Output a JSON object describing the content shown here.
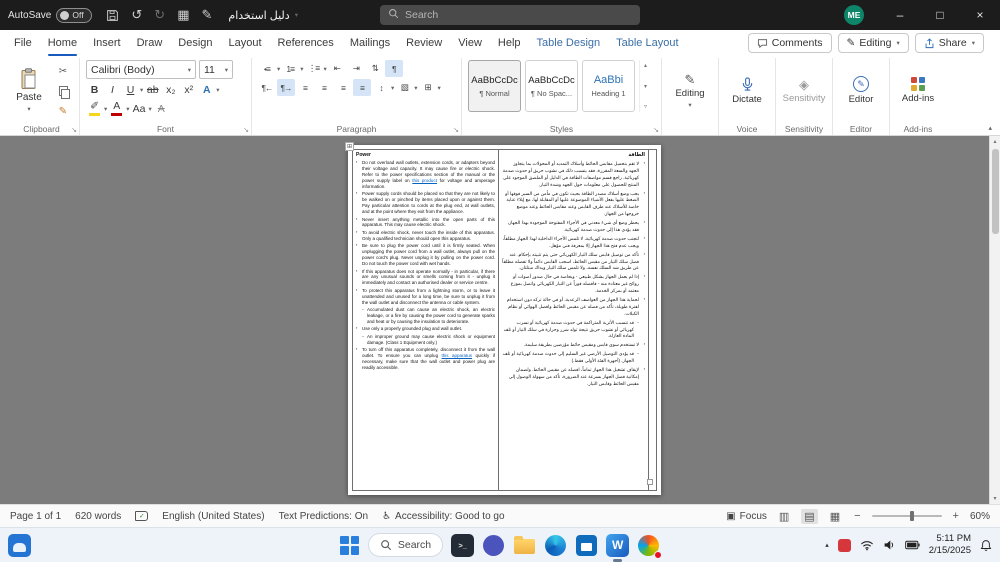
{
  "colors": {
    "accent_blue": "#185abd",
    "titlebar_bg": "#1c1c1c",
    "contextual_tab_blue": "#3a6ea5",
    "link_blue": "#0563c1",
    "heading_style_blue": "#2e74b5",
    "taskbar_bg": "#eef3f9",
    "notification_red": "#e81123"
  },
  "icons": {
    "undo": "↺",
    "redo": "↻",
    "table": "▦",
    "pen": "✎",
    "chevron_down": "▾",
    "minimize": "–",
    "maximize": "□",
    "close": "×",
    "cut": "✂",
    "format_painter": "✎",
    "launcher": "↘",
    "collapse": "▴",
    "bullets": "•≡",
    "numbering": "1≡",
    "multilevel": "⋮≡",
    "outdent": "⇤",
    "indent": "⇥",
    "sort": "⇅",
    "pilcrow": "¶",
    "rtl": "¶←",
    "ltr": "¶→",
    "align": "≡",
    "line_spacing": "↕",
    "shading": "▧",
    "borders": "⊞",
    "styles_up": "▴",
    "styles_down": "▾",
    "styles_more": "▿",
    "editing_pencil": "✎",
    "sensitivity": "◈",
    "editor_pencil": "✎",
    "highlight_pen": "✐",
    "focus": "▣",
    "view_read": "▥",
    "view_print": "▤",
    "view_web": "▦",
    "zoom_out": "−",
    "zoom_in": "+",
    "spell_check": "✓",
    "accessibility": "♿",
    "scroll_up": "▴",
    "scroll_down": "▾",
    "table_handle": "⊞",
    "tray_chevron": "▴",
    "terminal": ">_"
  },
  "titlebar": {
    "autosave_label": "AutoSave",
    "autosave_state": "Off",
    "doc_title": "دليل استخدام",
    "search_placeholder": "Search",
    "avatar": "ME"
  },
  "menubar": {
    "tabs": [
      "File",
      "Home",
      "Insert",
      "Draw",
      "Design",
      "Layout",
      "References",
      "Mailings",
      "Review",
      "View",
      "Help",
      "Table Design",
      "Table Layout"
    ],
    "active_tab": "Home",
    "comments": "Comments",
    "editing": "Editing",
    "share": "Share"
  },
  "ribbon": {
    "clipboard": {
      "paste": "Paste",
      "label": "Clipboard"
    },
    "font": {
      "name": "Calibri (Body)",
      "size": "11",
      "label": "Font",
      "bold": "B",
      "italic": "I",
      "underline": "U",
      "strike": "ab",
      "subscript": "x₂",
      "superscript": "x²",
      "effects": "A",
      "color": "A",
      "change_case": "Aa",
      "clear": "A"
    },
    "paragraph": {
      "label": "Paragraph"
    },
    "styles": {
      "label": "Styles",
      "items": [
        {
          "preview": "AaBbCcDc",
          "name": "¶ Normal"
        },
        {
          "preview": "AaBbCcDc",
          "name": "¶ No Spac..."
        },
        {
          "preview": "AaBbi",
          "name": "Heading 1"
        }
      ]
    },
    "editing": {
      "button": "Editing"
    },
    "voice": {
      "button": "Dictate",
      "label": "Voice"
    },
    "sensitivity": {
      "button": "Sensitivity",
      "label": "Sensitivity"
    },
    "editor": {
      "button": "Editor",
      "label": "Editor"
    },
    "addins": {
      "button": "Add-ins",
      "label": "Add-ins"
    }
  },
  "document": {
    "heading_en": "Power",
    "heading_ar": "الطاقة",
    "english": [
      {
        "t1": "Do not overload wall outlets, extension cords, or adapters beyond their voltage and capacity. It may cause fire or electric shock. Refer to the power specifications section of the manual or the power supply label on ",
        "link": "this product",
        "t2": " for voltage and amperage information."
      },
      "Power supply cords should be placed so that they are not likely to be walked on or pinched by items placed upon or against them. Pay particular attention to cords at the plug end, at wall outlets, and at the point where they exit from the appliance.",
      "Never insert anything metallic into the open parts of this apparatus. This may cause electric shock.",
      "To avoid electric shock, never touch the inside of this apparatus. Only a qualified technician should open this apparatus.",
      "Be sure to plug the power cord until it is firmly seated. When unplugging the power cord from a wall outlet, always pull on the power cord's plug. Never unplug it by pulling on the power cord. Do not touch the power cord with wet hands.",
      "If this apparatus does not operate normally - in particular, if there are any unusual sounds or smells coming from it - unplug it immediately and contact an authorised dealer or service centre.",
      "To protect this apparatus from a lightning storm, or to leave it unattended and unused for a long time, be sure to unplug it from the wall outlet and disconnect the antenna or cable system.",
      "Accumulated dust can cause an electric shock, an electric leakage, or a fire by causing the power cord to generate sparks and heat or by causing the insulation to deteriorate.",
      "Use only a properly grounded plug and wall outlet.",
      "An improper ground may cause electric shock or equipment damage. (Class 1 Equipment only.)",
      {
        "t1": "To turn off this apparatus completely, disconnect it from the wall outlet. To ensure you can unplug ",
        "link": "this apparatus",
        "t2": " quickly if necessary, make sure that the wall outlet and power plug are readily accessible."
      }
    ],
    "arabic": [
      "لا تقم بتحميل مقابس الحائط وأسلاك التمديد أو المحولات بما يتجاوز الجهد والسعة المقررة، فقد يتسبب ذلك في نشوب حريق أو حدوث صدمة كهربائية. راجع قسم مواصفات الطاقة في الدليل أو الملصق الموجود على المنتج للحصول على معلومات حول الجهد وشدة التيار.",
      "يجب وضع أسلاك مصدر الطاقة بحيث تكون في مأمن من السير فوقها أو الضغط عليها بفعل الأشياء الموضوعة عليها أو المقابلة لها، مع إيلاء عناية خاصة للأسلاك عند طرف القابس وعند مقابس الحائط وعند موضع خروجها من الجهاز.",
      "يحظر وضع أي شيء معدني في الأجزاء المفتوحة الموجودة بهذا الجهاز، فقد يؤدي هذا إلى حدوث صدمة كهربائية.",
      "لتجنب حدوث صدمة كهربائية، لا تلمس الأجزاء الداخلية لهذا الجهاز مطلقاً، ويجب عدم فتح هذا الجهاز إلا بمعرفة فني مؤهل.",
      "تأكد من توصيل قابس سلك التيار الكهربائي حتى يتم تثبيته بإحكام. عند فصل سلك التيار من مقبس الحائط، اسحب القابس دائماً ولا تفصله مطلقاً عن طريق شد السلك نفسه، ولا تلمس سلك التيار ويداك مبتلتان.",
      "إذا لم يعمل الجهاز بشكل طبيعي - وبخاصة في حال صدور أصوات أو روائح غير معتادة منه - فافصله فوراً عن التيار الكهربائي واتصل بموزع معتمد أو بمركز الخدمة.",
      "لحماية هذا الجهاز من العواصف الرعدية، أو في حالة تركه دون استخدام لفترة طويلة، تأكد من فصله عن مقبس الحائط وافصل الهوائي أو نظام الكبلات.",
      "قد تتسبب الأتربة المتراكمة في حدوث صدمة كهربائية أو تسرب كهربائي أو نشوب حريق نتيجة تولد شرر وحرارة في سلك التيار أو تلف المادة العازلة.",
      "لا تستخدم سوى قابس ومقبس حائط مؤرضين بطريقة سليمة.",
      "قد يؤدي التوصيل الأرضي غير السليم إلى حدوث صدمة كهربائية أو تلف الجهاز. (أجهزة الفئة الأولى فقط.)",
      "لإيقاف تشغيل هذا الجهاز تماماً، افصله عن مقبس الحائط. ولضمان إمكانية فصل الجهاز بسرعة عند الضرورة، تأكد من سهولة الوصول إلى مقبس الحائط وقابس التيار."
    ]
  },
  "statusbar": {
    "page": "Page 1 of 1",
    "words": "620 words",
    "language": "English (United States)",
    "predictions": "Text Predictions: On",
    "accessibility": "Accessibility: Good to go",
    "focus": "Focus",
    "zoom": "60%"
  },
  "taskbar": {
    "search": "Search",
    "word_initial": "W",
    "time": "5:11 PM",
    "date": "2/15/2025"
  }
}
